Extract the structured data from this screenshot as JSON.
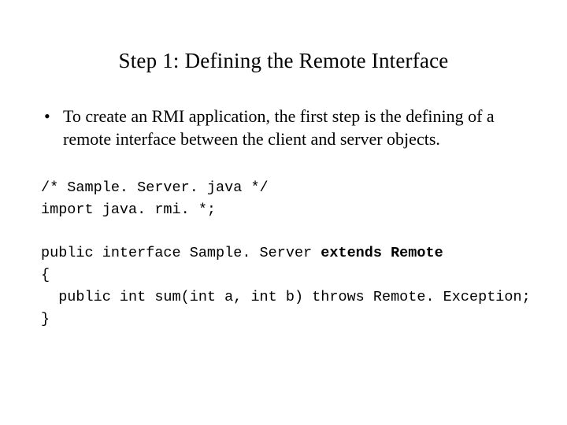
{
  "title": "Step 1:  Defining the Remote Interface",
  "bullet": "To create an RMI application, the first step is the defining of a remote interface between the client and server objects.",
  "code": {
    "l1": "/* Sample. Server. java */",
    "l2": "import java. rmi. *;",
    "l3": "",
    "l4a": "public interface Sample. Server ",
    "l4b": "extends Remote",
    "l5": "{",
    "l6": "  public int sum(int a, int b) throws Remote. Exception;",
    "l7": "}"
  }
}
